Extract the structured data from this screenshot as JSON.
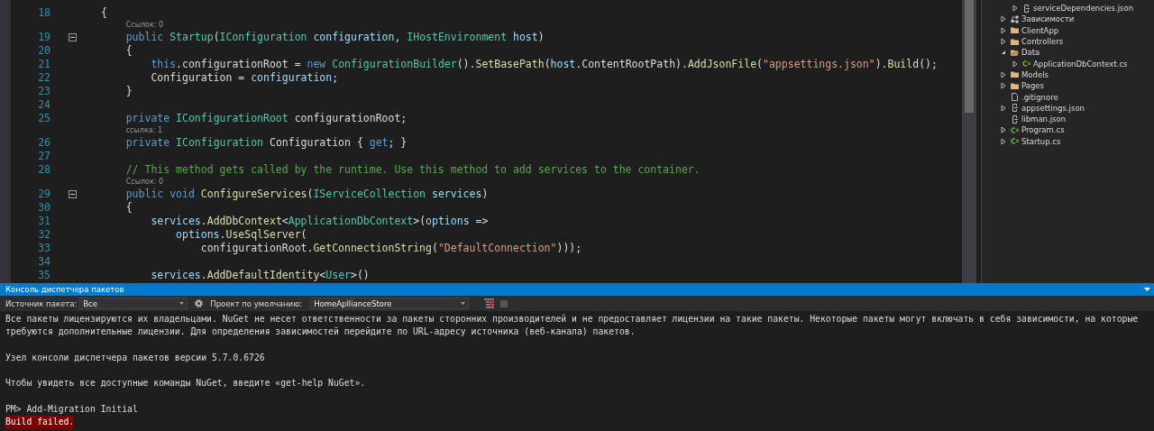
{
  "editor": {
    "lines": [
      {
        "number": "18",
        "foldable": false,
        "tokens": [
          {
            "kind": "plain",
            "text": "{"
          }
        ]
      },
      {
        "number": "19",
        "foldable": true,
        "codelens": "Ссылок: 0",
        "tokens": [
          {
            "kind": "keyword",
            "text": "    public "
          },
          {
            "kind": "type",
            "text": "Startup"
          },
          {
            "kind": "plain",
            "text": "("
          },
          {
            "kind": "type",
            "text": "IConfiguration "
          },
          {
            "kind": "param",
            "text": "configuration"
          },
          {
            "kind": "plain",
            "text": ", "
          },
          {
            "kind": "type",
            "text": "IHostEnvironment "
          },
          {
            "kind": "param",
            "text": "host"
          },
          {
            "kind": "plain",
            "text": ")"
          }
        ]
      },
      {
        "number": "20",
        "foldable": false,
        "tokens": [
          {
            "kind": "plain",
            "text": "    {"
          }
        ]
      },
      {
        "number": "21",
        "foldable": false,
        "tokens": [
          {
            "kind": "keyword",
            "text": "        this"
          },
          {
            "kind": "plain",
            "text": ".configurationRoot = "
          },
          {
            "kind": "keyword",
            "text": "new "
          },
          {
            "kind": "type",
            "text": "ConfigurationBuilder"
          },
          {
            "kind": "plain",
            "text": "()."
          },
          {
            "kind": "method",
            "text": "SetBasePath"
          },
          {
            "kind": "plain",
            "text": "("
          },
          {
            "kind": "param",
            "text": "host"
          },
          {
            "kind": "plain",
            "text": ".ContentRootPath)."
          },
          {
            "kind": "method",
            "text": "AddJsonFile"
          },
          {
            "kind": "plain",
            "text": "("
          },
          {
            "kind": "string",
            "text": "\"appsettings.json\""
          },
          {
            "kind": "plain",
            "text": ")."
          },
          {
            "kind": "method",
            "text": "Build"
          },
          {
            "kind": "plain",
            "text": "();"
          }
        ]
      },
      {
        "number": "22",
        "foldable": false,
        "tokens": [
          {
            "kind": "plain",
            "text": "        Configuration = "
          },
          {
            "kind": "param",
            "text": "configuration"
          },
          {
            "kind": "plain",
            "text": ";"
          }
        ]
      },
      {
        "number": "23",
        "foldable": false,
        "tokens": [
          {
            "kind": "plain",
            "text": "    }"
          }
        ]
      },
      {
        "number": "24",
        "foldable": false
      },
      {
        "number": "25",
        "foldable": false,
        "tokens": [
          {
            "kind": "keyword",
            "text": "    private "
          },
          {
            "kind": "type",
            "text": "IConfigurationRoot"
          },
          {
            "kind": "plain",
            "text": " configurationRoot;"
          }
        ]
      },
      {
        "number": "26",
        "foldable": false,
        "codelens": "ссылка: 1",
        "tokens": [
          {
            "kind": "keyword",
            "text": "    private "
          },
          {
            "kind": "type",
            "text": "IConfiguration"
          },
          {
            "kind": "plain",
            "text": " Configuration { "
          },
          {
            "kind": "keyword",
            "text": "get"
          },
          {
            "kind": "plain",
            "text": "; }"
          }
        ]
      },
      {
        "number": "27",
        "foldable": false
      },
      {
        "number": "28",
        "foldable": false,
        "tokens": [
          {
            "kind": "comment",
            "text": "    // This method gets called by the runtime. Use this method to add services to the container."
          }
        ]
      },
      {
        "number": "29",
        "foldable": true,
        "codelens": "Ссылок: 0",
        "tokens": [
          {
            "kind": "keyword",
            "text": "    public void "
          },
          {
            "kind": "method",
            "text": "ConfigureServices"
          },
          {
            "kind": "plain",
            "text": "("
          },
          {
            "kind": "type",
            "text": "IServiceCollection "
          },
          {
            "kind": "param",
            "text": "services"
          },
          {
            "kind": "plain",
            "text": ")"
          }
        ]
      },
      {
        "number": "30",
        "foldable": false,
        "tokens": [
          {
            "kind": "plain",
            "text": "    {"
          }
        ]
      },
      {
        "number": "31",
        "foldable": false,
        "tokens": [
          {
            "kind": "param",
            "text": "        services"
          },
          {
            "kind": "plain",
            "text": "."
          },
          {
            "kind": "method",
            "text": "AddDbContext"
          },
          {
            "kind": "plain",
            "text": "<"
          },
          {
            "kind": "type",
            "text": "ApplicationDbContext"
          },
          {
            "kind": "plain",
            "text": ">("
          },
          {
            "kind": "param",
            "text": "options"
          },
          {
            "kind": "plain",
            "text": " =>"
          }
        ]
      },
      {
        "number": "32",
        "foldable": false,
        "tokens": [
          {
            "kind": "param",
            "text": "            options"
          },
          {
            "kind": "plain",
            "text": "."
          },
          {
            "kind": "method",
            "text": "UseSqlServer"
          },
          {
            "kind": "plain",
            "text": "("
          }
        ]
      },
      {
        "number": "33",
        "foldable": false,
        "tokens": [
          {
            "kind": "plain",
            "text": "                configurationRoot."
          },
          {
            "kind": "method",
            "text": "GetConnectionString"
          },
          {
            "kind": "plain",
            "text": "("
          },
          {
            "kind": "string",
            "text": "\"DefaultConnection\""
          },
          {
            "kind": "plain",
            "text": ")));"
          }
        ]
      },
      {
        "number": "34",
        "foldable": false
      },
      {
        "number": "35",
        "foldable": false,
        "tokens": [
          {
            "kind": "param",
            "text": "        services"
          },
          {
            "kind": "plain",
            "text": "."
          },
          {
            "kind": "method",
            "text": "AddDefaultIdentity"
          },
          {
            "kind": "plain",
            "text": "<"
          },
          {
            "kind": "type",
            "text": "User"
          },
          {
            "kind": "plain",
            "text": ">()"
          }
        ]
      }
    ]
  },
  "solution_explorer": {
    "cut_parent_children": [
      {
        "label": "serviceDependencies.json",
        "kind": "json",
        "expanded": false
      }
    ],
    "items": [
      {
        "label": "Зависимости",
        "kind": "dependencies",
        "expanded": false
      },
      {
        "label": "ClientApp",
        "kind": "folder",
        "expanded": false
      },
      {
        "label": "Controllers",
        "kind": "folder",
        "expanded": false
      },
      {
        "label": "Data",
        "kind": "folder",
        "expanded": true,
        "children": [
          {
            "label": "ApplicationDbContext.cs",
            "kind": "csharp",
            "expanded": false
          }
        ]
      },
      {
        "label": "Models",
        "kind": "folder",
        "expanded": false
      },
      {
        "label": "Pages",
        "kind": "folder",
        "expanded": false
      },
      {
        "label": ".gitignore",
        "kind": "file"
      },
      {
        "label": "appsettings.json",
        "kind": "json",
        "expanded": false
      },
      {
        "label": "libman.json",
        "kind": "json"
      },
      {
        "label": "Program.cs",
        "kind": "csharp",
        "expanded": false
      },
      {
        "label": "Startup.cs",
        "kind": "csharp",
        "expanded": false
      }
    ]
  },
  "console": {
    "title": "Консоль диспетчера пакетов",
    "source_label": "Источник пакета:",
    "source_value": "Все",
    "project_label": "Проект по умолчанию:",
    "project_value": "HomeApllianceStore",
    "lines": [
      {
        "kind": "output",
        "text": "Все пакеты лицензируются их владельцами. NuGet не несет ответственности за пакеты сторонних производителей и не предоставляет лицензии на такие пакеты. Некоторые пакеты могут включать в себя зависимости, на которые"
      },
      {
        "kind": "output",
        "text": "требуются дополнительные лицензии. Для определения зависимостей перейдите по URL-адресу источника (веб-канала) пакетов."
      },
      {
        "kind": "blank"
      },
      {
        "kind": "output",
        "text": "Узел консоли диспетчера пакетов версии 5.7.0.6726"
      },
      {
        "kind": "blank"
      },
      {
        "kind": "output",
        "text": "Чтобы увидеть все доступные команды NuGet, введите «get-help NuGet»."
      },
      {
        "kind": "blank"
      },
      {
        "kind": "output",
        "text": "PM> Add-Migration Initial"
      },
      {
        "kind": "error",
        "text": "Build failed."
      }
    ]
  }
}
